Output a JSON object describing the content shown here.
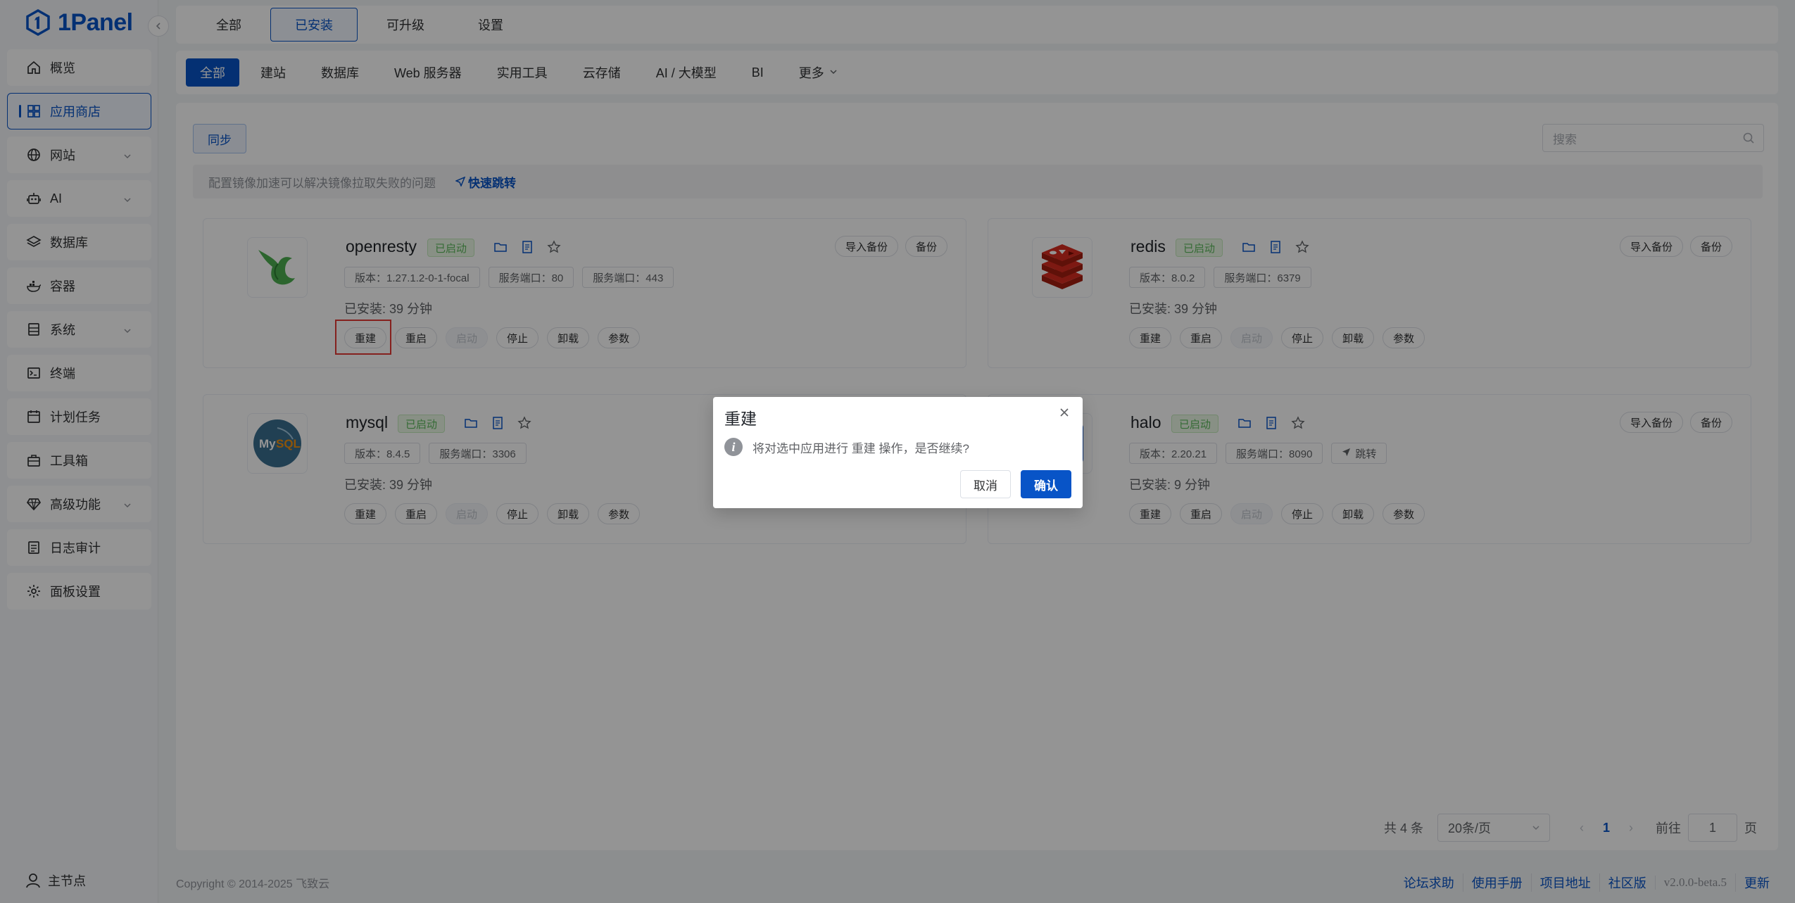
{
  "brand": {
    "name": "1Panel",
    "color": "#0854c7"
  },
  "sidebar": {
    "items": [
      {
        "label": "概览",
        "icon": "home-icon",
        "chevron": false,
        "active": false
      },
      {
        "label": "应用商店",
        "icon": "grid-icon",
        "chevron": false,
        "active": true
      },
      {
        "label": "网站",
        "icon": "globe-icon",
        "chevron": true,
        "active": false
      },
      {
        "label": "AI",
        "icon": "robot-icon",
        "chevron": true,
        "active": false
      },
      {
        "label": "数据库",
        "icon": "layers-icon",
        "chevron": false,
        "active": false
      },
      {
        "label": "容器",
        "icon": "docker-icon",
        "chevron": false,
        "active": false
      },
      {
        "label": "系统",
        "icon": "server-icon",
        "chevron": true,
        "active": false
      },
      {
        "label": "终端",
        "icon": "terminal-icon",
        "chevron": false,
        "active": false
      },
      {
        "label": "计划任务",
        "icon": "calendar-icon",
        "chevron": false,
        "active": false
      },
      {
        "label": "工具箱",
        "icon": "toolbox-icon",
        "chevron": false,
        "active": false
      },
      {
        "label": "高级功能",
        "icon": "diamond-icon",
        "chevron": true,
        "active": false
      },
      {
        "label": "日志审计",
        "icon": "log-icon",
        "chevron": false,
        "active": false
      },
      {
        "label": "面板设置",
        "icon": "gear-icon",
        "chevron": false,
        "active": false
      }
    ],
    "node_label": "主节点"
  },
  "top_tabs": [
    {
      "label": "全部",
      "active": false
    },
    {
      "label": "已安装",
      "active": true
    },
    {
      "label": "可升级",
      "active": false
    },
    {
      "label": "设置",
      "active": false
    }
  ],
  "categories": [
    {
      "label": "全部",
      "active": true
    },
    {
      "label": "建站",
      "active": false
    },
    {
      "label": "数据库",
      "active": false
    },
    {
      "label": "Web 服务器",
      "active": false
    },
    {
      "label": "实用工具",
      "active": false
    },
    {
      "label": "云存储",
      "active": false
    },
    {
      "label": "AI / 大模型",
      "active": false
    },
    {
      "label": "BI",
      "active": false
    },
    {
      "label": "更多",
      "active": false
    }
  ],
  "toolbar": {
    "sync_label": "同步",
    "search_placeholder": "搜索"
  },
  "notice": {
    "text": "配置镜像加速可以解决镜像拉取失败的问题",
    "link": "快速跳转"
  },
  "apps": [
    {
      "name": "openresty",
      "status": "已启动",
      "meta": [
        "版本：1.27.1.2-0-1-focal",
        "服务端口：80",
        "服务端口：443"
      ],
      "installed": "已安装:  39 分钟",
      "logo": "openresty-logo"
    },
    {
      "name": "redis",
      "status": "已启动",
      "meta": [
        "版本：8.0.2",
        "服务端口：6379"
      ],
      "installed": "已安装:  39 分钟",
      "logo": "redis-logo"
    },
    {
      "name": "mysql",
      "status": "已启动",
      "meta": [
        "版本：8.4.5",
        "服务端口：3306"
      ],
      "installed": "已安装:  39 分钟",
      "logo": "mysql-logo"
    },
    {
      "name": "halo",
      "status": "已启动",
      "meta": [
        "版本：2.20.21",
        "服务端口：8090",
        "跳转"
      ],
      "installed": "已安装:  9 分钟",
      "logo": "halo-logo"
    }
  ],
  "card_buttons": {
    "import_backup": "导入备份",
    "backup": "备份",
    "ops": [
      "重建",
      "重启",
      "启动",
      "停止",
      "卸载",
      "参数"
    ],
    "disabled_op": "启动",
    "mysql_logo_text": "MySQL"
  },
  "pagination": {
    "total": "共 4 条",
    "page_size": "20条/页",
    "prev": "‹",
    "current_page": "1",
    "next": "›",
    "goto_label": "前往",
    "goto_value": "1",
    "page_suffix": "页"
  },
  "footer": {
    "copyright": "Copyright © 2014-2025 飞致云",
    "links": [
      "论坛求助",
      "使用手册",
      "项目地址",
      "社区版"
    ],
    "version": "v2.0.0-beta.5",
    "update": "更新"
  },
  "dialog": {
    "title": "重建",
    "message": "将对选中应用进行 重建 操作，是否继续?",
    "cancel": "取消",
    "confirm": "确认"
  }
}
